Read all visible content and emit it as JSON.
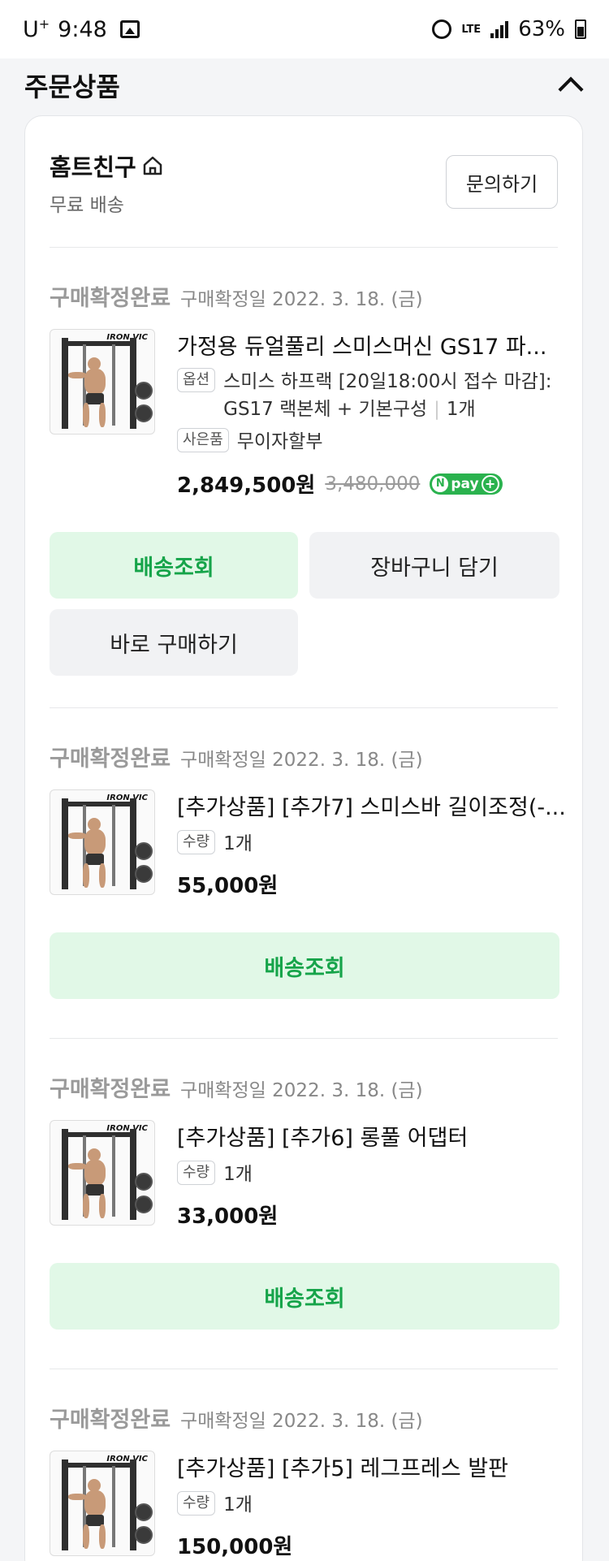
{
  "status_bar": {
    "carrier": "U",
    "carrier_sup": "+",
    "time": "9:48",
    "network": "LTE",
    "battery": "63%"
  },
  "section": {
    "title": "주문상품"
  },
  "store": {
    "name": "홈트친구",
    "shipping": "무료 배송",
    "inquiry_label": "문의하기"
  },
  "items": [
    {
      "status": "구매확정완료",
      "confirm_date": "구매확정일 2022. 3. 18. (금)",
      "title": "가정용 듀얼풀리 스미스머신 GS17 파...",
      "option_tag": "옵션",
      "option_line1": "스미스 하프랙 [20일18:00시 접수 마감]:",
      "option_line2": "GS17 랙본체 + 기본구성",
      "quantity": "1개",
      "gift_tag": "사은품",
      "gift": "무이자할부",
      "price": "2,849,500원",
      "original_price": "3,480,000",
      "npay": "pay",
      "buttons": [
        "배송조회",
        "장바구니 담기",
        "바로 구매하기"
      ]
    },
    {
      "status": "구매확정완료",
      "confirm_date": "구매확정일 2022. 3. 18. (금)",
      "title": "[추가상품] [추가7] 스미스바 길이조정(-...",
      "qty_tag": "수량",
      "quantity": "1개",
      "price": "55,000원",
      "button": "배송조회"
    },
    {
      "status": "구매확정완료",
      "confirm_date": "구매확정일 2022. 3. 18. (금)",
      "title": "[추가상품] [추가6] 롱풀 어댑터",
      "qty_tag": "수량",
      "quantity": "1개",
      "price": "33,000원",
      "button": "배송조회"
    },
    {
      "status": "구매확정완료",
      "confirm_date": "구매확정일 2022. 3. 18. (금)",
      "title": "[추가상품] [추가5] 레그프레스 발판",
      "qty_tag": "수량",
      "quantity": "1개",
      "price": "150,000원"
    }
  ],
  "thumbnail_brand": "IRON VIC",
  "colors": {
    "accent_green": "#16a44a",
    "button_green_bg": "#e1f8e7",
    "npay_green": "#2ab24e"
  }
}
